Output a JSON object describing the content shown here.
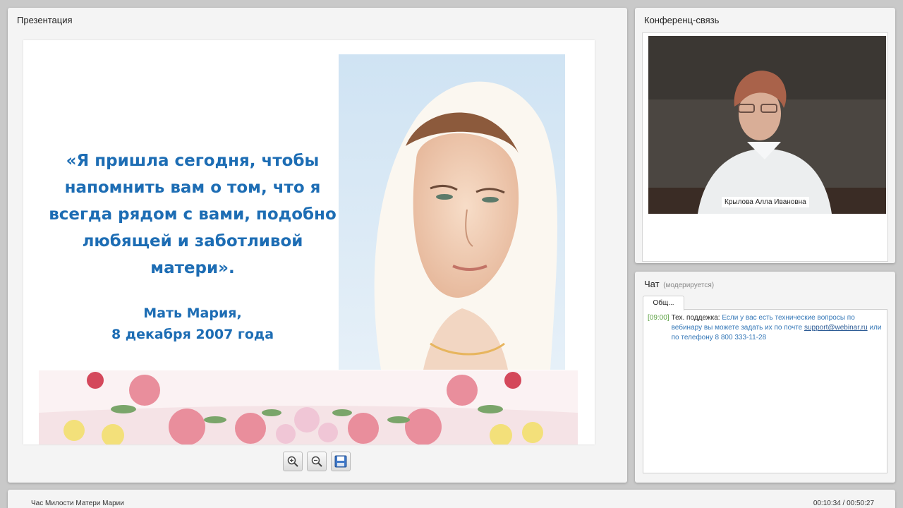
{
  "presentation": {
    "title": "Презентация",
    "slide": {
      "quote": "«Я пришла сегодня, чтобы напомнить вам о том, что я всегда рядом с вами, подобно любящей и заботливой матери».",
      "author_line1": "Мать Мария,",
      "author_line2": "8 декабря 2007 года"
    },
    "tools": {
      "zoom_in": "zoom-in-icon",
      "zoom_out": "zoom-out-icon",
      "save": "save-icon"
    }
  },
  "conference": {
    "title": "Конференц-связь",
    "participant_name": "Крылова Алла Ивановна"
  },
  "chat": {
    "title": "Чат",
    "moderated": "(модерируется)",
    "tab": "Общ...",
    "messages": [
      {
        "time": "[09:00]",
        "author": "Тех. поддежка:",
        "text": "Если у вас есть технические вопросы по вебинару вы можете задать их по почте",
        "email": "support@webinar.ru",
        "text2": "или по телефону 8 800 333-11-28"
      }
    ]
  },
  "footer": {
    "event_title": "Час Милости Матери Марии",
    "timer": "00:10:34 / 00:50:27"
  },
  "colors": {
    "slide_text": "#1d6db4",
    "chat_text": "#3477b7",
    "chat_time": "#5aa040"
  }
}
